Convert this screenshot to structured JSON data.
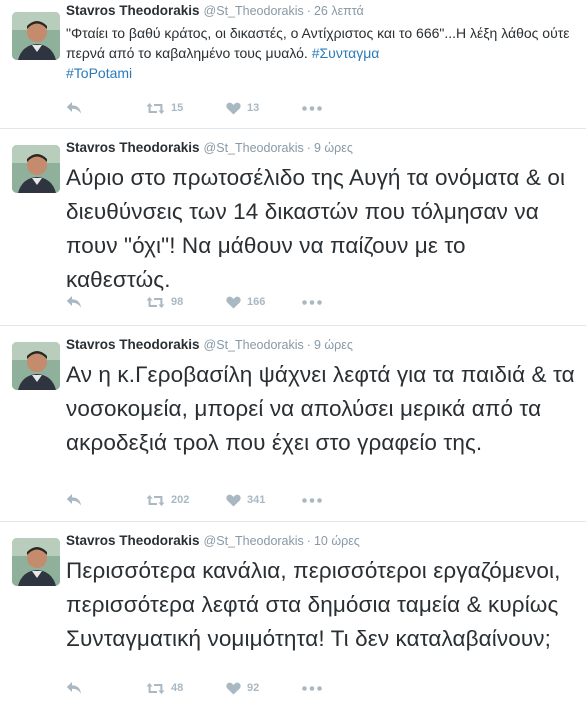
{
  "author": {
    "name": "Stavros Theodorakis",
    "handle": "@St_Theodorakis"
  },
  "icons": {
    "reply": "reply-icon",
    "retweet": "retweet-icon",
    "like": "heart-icon",
    "more": "more-dots-icon"
  },
  "colors": {
    "hashtag": "#2b7bb9",
    "muted": "#8899a6",
    "action": "#aab8c2",
    "divider": "#e1e8ed"
  },
  "tweets": [
    {
      "sep": "·",
      "time": "26 λεπτά",
      "text": "\"Φταίει το βαθύ κράτος, οι δικαστές, ο Αντίχριστος και το 666\"...Η λέξη λάθος ούτε περνά από το καβαλημένο τους μυαλό. ",
      "hashtags": [
        "#Συνταγμα",
        "#ToPotami"
      ],
      "retweets": "15",
      "likes": "13"
    },
    {
      "sep": "·",
      "time": "9 ώρες",
      "text": "Αύριο στο πρωτοσέλιδο της Αυγή τα ονόματα & οι διευθύνσεις των 14 δικαστών που τόλμησαν να πουν \"όχι\"! Να μάθουν να παίζουν με το καθεστώς.",
      "retweets": "98",
      "likes": "166"
    },
    {
      "sep": "·",
      "time": "9 ώρες",
      "text": "Αν η κ.Γεροβασίλη ψάχνει λεφτά για τα παιδιά & τα νοσοκομεία, μπορεί να απολύσει μερικά από τα ακροδεξιά τρολ που έχει στο γραφείο της.",
      "retweets": "202",
      "likes": "341"
    },
    {
      "sep": "·",
      "time": "10 ώρες",
      "text": "Περισσότερα κανάλια, περισσότεροι εργαζόμενοι, περισσότερα λεφτά στα δημόσια ταμεία & κυρίως Συνταγματική νομιμότητα! Τι δεν καταλαβαίνουν;",
      "retweets": "48",
      "likes": "92"
    }
  ]
}
